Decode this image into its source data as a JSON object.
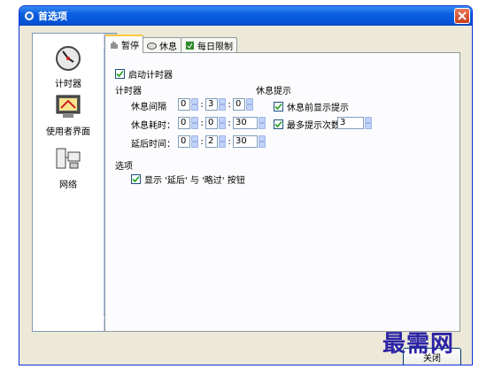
{
  "window": {
    "title": "首选项"
  },
  "sidebar": {
    "items": [
      {
        "label": "计时器",
        "icon": "timer-icon"
      },
      {
        "label": "使用者界面",
        "icon": "user-interface-icon"
      },
      {
        "label": "网络",
        "icon": "network-icon"
      }
    ]
  },
  "tabs": [
    {
      "label": "暂停",
      "icon": "pause-hand-icon",
      "active": true
    },
    {
      "label": "休息",
      "icon": "rest-icon",
      "active": false
    },
    {
      "label": "每日限制",
      "icon": "daily-limit-icon",
      "active": false
    }
  ],
  "pause": {
    "enable_timer": "启动计时器",
    "timer_section": "计时器",
    "interval_label": "休息间隔",
    "interval": [
      "0",
      "3",
      "0"
    ],
    "duration_label": "休息耗时：",
    "duration": [
      "0",
      "0",
      "30"
    ],
    "delay_label": "延后时间：",
    "delay": [
      "0",
      "2",
      "30"
    ],
    "reminder_section": "休息提示",
    "show_before": "休息前显示提示",
    "max_prompts_label": "最多提示次数",
    "max_prompts": "3",
    "options_section": "选项",
    "show_buttons": "显示 '延后' 与 '略过' 按钮"
  },
  "footer": {
    "button_label": "关闭"
  },
  "watermark": "最需网",
  "colors": {
    "title_bar": "#0a5fe0",
    "close": "#c93e1d",
    "tab_highlight": "#ffc83c"
  }
}
